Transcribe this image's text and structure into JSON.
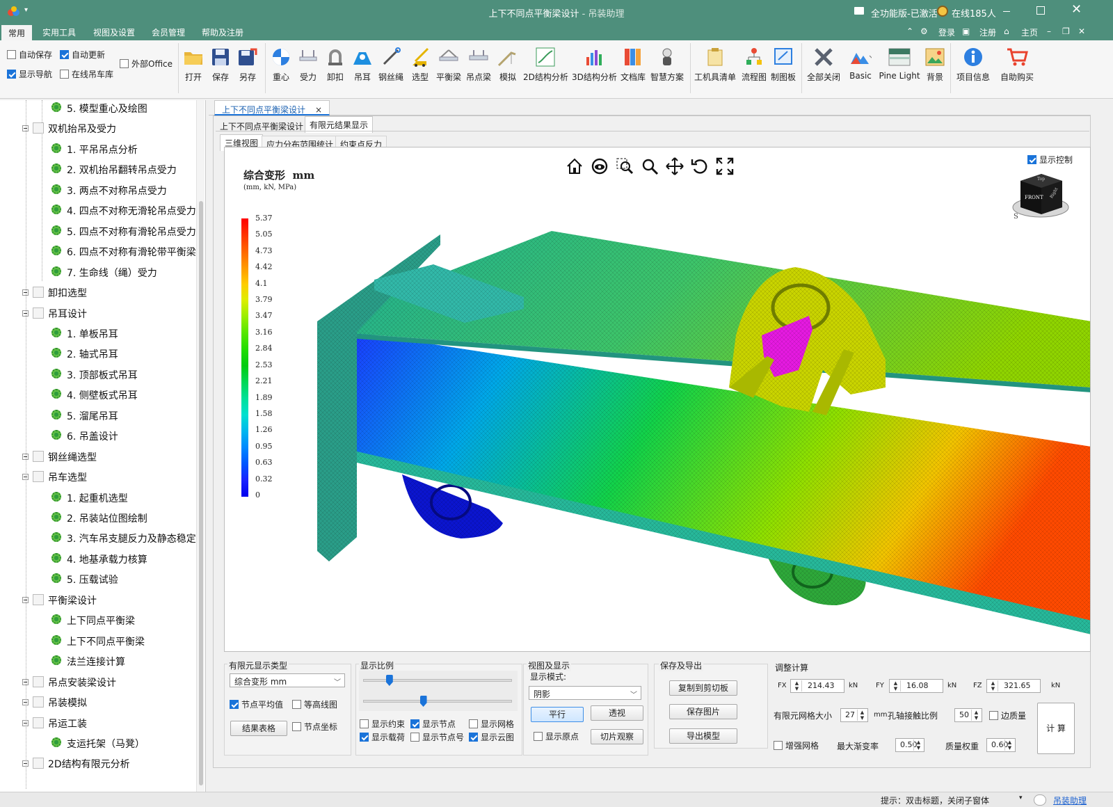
{
  "title": {
    "main": "上下不同点平衡梁设计",
    "sep": " - ",
    "app": "吊装助理"
  },
  "titlebar_right": {
    "edition": "全功能版-已激活",
    "online": "在线185人"
  },
  "menu": [
    "常用",
    "实用工具",
    "视图及设置",
    "会员管理",
    "帮助及注册"
  ],
  "menu_right": {
    "login": "登录",
    "register": "注册",
    "home": "主页"
  },
  "options": {
    "autosave": {
      "label": "自动保存",
      "checked": false
    },
    "autoupdate": {
      "label": "自动更新",
      "checked": true
    },
    "external_office": {
      "label": "外部Office",
      "checked": false
    },
    "show_nav": {
      "label": "显示导航",
      "checked": true
    },
    "crane_lib": {
      "label": "在线吊车库",
      "checked": false
    }
  },
  "ribbon": [
    "打开",
    "保存",
    "另存",
    "重心",
    "受力",
    "卸扣",
    "吊耳",
    "钢丝绳",
    "选型",
    "平衡梁",
    "吊点梁",
    "模拟",
    "2D结构分析",
    "3D结构分析",
    "文档库",
    "智慧方案",
    "工机具清单",
    "流程图",
    "制图板",
    "全部关闭",
    "Basic",
    "Pine Light",
    "背景",
    "项目信息",
    "自助购买"
  ],
  "tree": [
    {
      "label": "5. 模型重心及绘图",
      "level": 2
    },
    {
      "label": "双机抬吊及受力",
      "level": 1
    },
    {
      "label": "1. 平吊吊点分析",
      "level": 2
    },
    {
      "label": "2. 双机抬吊翻转吊点受力",
      "level": 2
    },
    {
      "label": "3. 两点不对称吊点受力",
      "level": 2
    },
    {
      "label": "4. 四点不对称无滑轮吊点受力",
      "level": 2
    },
    {
      "label": "5. 四点不对称有滑轮吊点受力",
      "level": 2
    },
    {
      "label": "6. 四点不对称有滑轮带平衡梁",
      "level": 2
    },
    {
      "label": "7. 生命线（绳）受力",
      "level": 2
    },
    {
      "label": "卸扣选型",
      "level": 1
    },
    {
      "label": "吊耳设计",
      "level": 1
    },
    {
      "label": "1. 单板吊耳",
      "level": 2
    },
    {
      "label": "2. 轴式吊耳",
      "level": 2
    },
    {
      "label": "3. 顶部板式吊耳",
      "level": 2
    },
    {
      "label": "4. 侧壁板式吊耳",
      "level": 2
    },
    {
      "label": "5. 溜尾吊耳",
      "level": 2
    },
    {
      "label": "6. 吊盖设计",
      "level": 2
    },
    {
      "label": "钢丝绳选型",
      "level": 1
    },
    {
      "label": "吊车选型",
      "level": 1
    },
    {
      "label": "1. 起重机选型",
      "level": 2
    },
    {
      "label": "2. 吊装站位图绘制",
      "level": 2
    },
    {
      "label": "3. 汽车吊支腿反力及静态稳定",
      "level": 2
    },
    {
      "label": "4. 地基承载力核算",
      "level": 2
    },
    {
      "label": "5. 压载试验",
      "level": 2
    },
    {
      "label": "平衡梁设计",
      "level": 1
    },
    {
      "label": "上下同点平衡梁",
      "level": 2
    },
    {
      "label": "上下不同点平衡梁",
      "level": 2
    },
    {
      "label": "法兰连接计算",
      "level": 2
    },
    {
      "label": "吊点安装梁设计",
      "level": 1
    },
    {
      "label": "吊装模拟",
      "level": 1
    },
    {
      "label": "吊运工装",
      "level": 1
    },
    {
      "label": "支运托架（马凳）",
      "level": 2
    },
    {
      "label": "2D结构有限元分析",
      "level": 1
    }
  ],
  "doc_tab": "上下不同点平衡梁设计",
  "doc_tab_close": "×",
  "sub_tabs": [
    "上下不同点平衡梁设计",
    "有限元结果显示"
  ],
  "view_tabs": [
    "三维视图",
    "应力分布范围统计",
    "约束点反力"
  ],
  "viewport": {
    "title": "综合变形  mm",
    "units": "(mm, kN, MPa)",
    "show_control": {
      "label": "显示控制",
      "checked": true
    },
    "legend_values": [
      "5.37",
      "5.05",
      "4.73",
      "4.42",
      "4.1",
      "3.79",
      "3.47",
      "3.16",
      "2.84",
      "2.53",
      "2.21",
      "1.89",
      "1.58",
      "1.26",
      "0.95",
      "0.63",
      "0.32",
      "0"
    ],
    "legend_colors": [
      "#ff0000",
      "#ff3300",
      "#ff6600",
      "#ff9900",
      "#ffcc00",
      "#ddee00",
      "#99ee00",
      "#55e600",
      "#22dd00",
      "#00cc11",
      "#00d855",
      "#00e099",
      "#00e0d0",
      "#00b6ee",
      "#0088ff",
      "#0055ff",
      "#1a22ff",
      "#0000ee"
    ],
    "cube_labels": {
      "front": "FRONT",
      "top": "Top",
      "right": "Right",
      "south": "S"
    }
  },
  "panel_fe": {
    "title": "有限元显示类型",
    "type_value": "综合变形 mm",
    "node_avg": {
      "label": "节点平均值",
      "checked": true
    },
    "contour": {
      "label": "等高线图",
      "checked": false
    },
    "result_table": "结果表格",
    "node_coord": {
      "label": "节点坐标",
      "checked": false
    }
  },
  "panel_scale": {
    "title": "显示比例",
    "slider1": 0.15,
    "slider2": 0.38,
    "show_constraint": {
      "label": "显示约束",
      "checked": false
    },
    "show_node": {
      "label": "显示节点",
      "checked": true
    },
    "show_mesh": {
      "label": "显示网格",
      "checked": false
    },
    "show_load": {
      "label": "显示载荷",
      "checked": true
    },
    "show_node_no": {
      "label": "显示节点号",
      "checked": false
    },
    "show_cloud": {
      "label": "显示云图",
      "checked": true
    }
  },
  "panel_view": {
    "title": "视图及显示",
    "mode_label": "显示模式:",
    "mode_value": "阴影",
    "parallel": "平行",
    "perspective": "透视",
    "show_origin": {
      "label": "显示原点",
      "checked": false
    },
    "slice": "切片观察"
  },
  "panel_save": {
    "title": "保存及导出",
    "copy": "复制到剪切板",
    "save_image": "保存图片",
    "export_model": "导出模型"
  },
  "panel_calc": {
    "title": "调整计算",
    "fx_label": "FX",
    "fx": "214.43",
    "fx_unit": "kN",
    "fy_label": "FY",
    "fy": "16.08",
    "fy_unit": "kN",
    "fz_label": "FZ",
    "fz": "321.65",
    "fz_unit": "kN",
    "mesh_label": "有限元网格大小",
    "mesh": "27",
    "mesh_unit": "mm",
    "contact_label": "孔轴接触比例",
    "contact": "50",
    "edge_mass": {
      "label": "边质量",
      "checked": false
    },
    "refine": {
      "label": "增强网格",
      "checked": false
    },
    "max_grad_label": "最大渐变率",
    "max_grad": "0.50",
    "mass_weight_label": "质量权重",
    "mass_weight": "0.60",
    "calc_button": "计 算"
  },
  "status": {
    "hint": "提示：双击标题，关闭子窗体",
    "link": "吊装助理"
  }
}
